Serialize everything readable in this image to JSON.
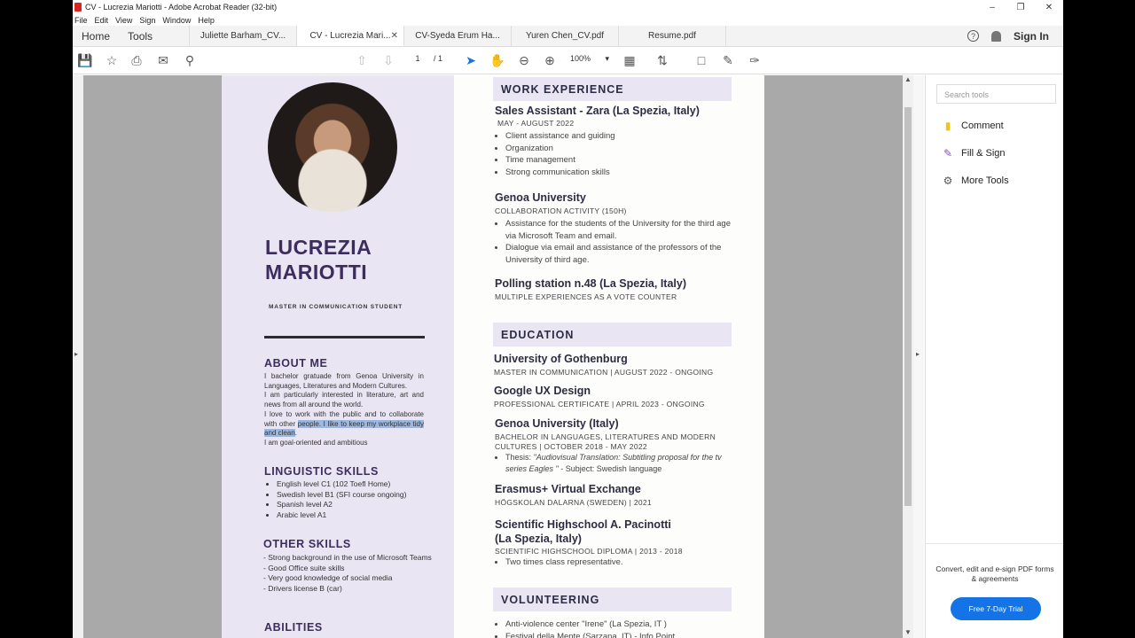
{
  "window": {
    "title": "CV - Lucrezia Mariotti - Adobe Acrobat Reader (32-bit)"
  },
  "menu": [
    "File",
    "Edit",
    "View",
    "Sign",
    "Window",
    "Help"
  ],
  "nav": {
    "home": "Home",
    "tools": "Tools"
  },
  "tabs": [
    {
      "label": "Juliette Barham_CV..."
    },
    {
      "label": "CV - Lucrezia Mari..."
    },
    {
      "label": "CV-Syeda Erum Ha..."
    },
    {
      "label": "Yuren Chen_CV.pdf"
    },
    {
      "label": "Resume.pdf"
    }
  ],
  "header": {
    "signin": "Sign In"
  },
  "toolbar": {
    "page_current": "1",
    "page_total": "/ 1",
    "zoom": "100%"
  },
  "cv": {
    "name_line1": "LUCREZIA",
    "name_line2": "MARIOTTI",
    "role": "MASTER IN COMMUNICATION STUDENT",
    "about_title": "ABOUT ME",
    "about_p1": "I bachelor gratuade from Genoa University in Languages, Literatures and Modern Cultures.",
    "about_p2": "I am particularly interested in literature, art and news from all around the world.",
    "about_p3a": "I love to work with the public and to collaborate with other ",
    "about_p3b": "people. I like to keep my workplace tidy and clean",
    "about_p3c": ".",
    "about_p4": "I am goal-oriented and ambitious",
    "ling_title": "LINGUISTIC SKILLS",
    "ling": [
      "English level C1 (102 Toefl Home)",
      "Swedish level B1 (SFI course ongoing)",
      "Spanish level A2",
      "Arabic level A1"
    ],
    "other_title": "OTHER SKILLS",
    "other": [
      "- Strong background in the use of Microsoft Teams",
      "- Good Office suite skills",
      "- Very good knowledge of social media",
      "- Drivers license B (car)"
    ],
    "abilities_title": "ABILITIES",
    "work_title": "WORK EXPERIENCE",
    "job1_title": "Sales Assistant - Zara (La Spezia, Italy)",
    "job1_sub": "MAY - AUGUST 2022",
    "job1_items": [
      "Client assistance and guiding",
      "Organization",
      "Time management",
      "Strong communication skills"
    ],
    "job2_title": "Genoa University",
    "job2_sub": "COLLABORATION ACTIVITY (150H)",
    "job2_items": [
      "Assistance for the students of the University for the third age via Microsoft Team and email.",
      "Dialogue via email and assistance of the professors of the University of third age."
    ],
    "job3_title": "Polling station n.48 (La Spezia, Italy)",
    "job3_sub": "MULTIPLE EXPERIENCES AS A VOTE COUNTER",
    "edu_title": "EDUCATION",
    "edu1_title": "University of Gothenburg",
    "edu1_sub": "MASTER IN COMMUNICATION | AUGUST 2022 -  ONGOING",
    "edu2_title": "Google UX Design",
    "edu2_sub": "PROFESSIONAL CERTIFICATE | APRIL 2023 - ONGOING",
    "edu3_title": "Genoa University (Italy)",
    "edu3_sub1": "BACHELOR IN LANGUAGES, LITERATURES AND MODERN",
    "edu3_sub2": "CULTURES | OCTOBER 2018 -  MAY 2022",
    "edu3_thesis_a": "Thesis: ",
    "edu3_thesis_b": "\"Audiovisual Translation: Subtitling proposal for the tv series Eagles \"",
    "edu3_thesis_c": " - Subject: Swedish language",
    "edu4_title": "Erasmus+ Virtual Exchange",
    "edu4_sub": "HÖGSKOLAN DALARNA (SWEDEN) | 2021",
    "edu5_title1": "Scientific Highschool A. Pacinotti",
    "edu5_title2": "(La Spezia, Italy)",
    "edu5_sub": "SCIENTIFIC HIGHSCHOOL DIPLOMA | 2013 - 2018",
    "edu5_item": "Two times class representative.",
    "vol_title": "VOLUNTEERING",
    "vol_items": [
      "Anti-violence center \"Irene\" (La Spezia, IT )",
      "Festival della Mente (Sarzana, IT) - Info Point"
    ]
  },
  "rightpanel": {
    "search_placeholder": "Search tools",
    "tools": [
      "Comment",
      "Fill & Sign",
      "More Tools"
    ],
    "promo": "Convert, edit and e-sign PDF forms & agreements",
    "trial": "Free 7-Day Trial"
  },
  "colors": {
    "accent": "#3d2d5e",
    "sidebar": "#e9e5f2",
    "trial_button": "#1473e6"
  }
}
